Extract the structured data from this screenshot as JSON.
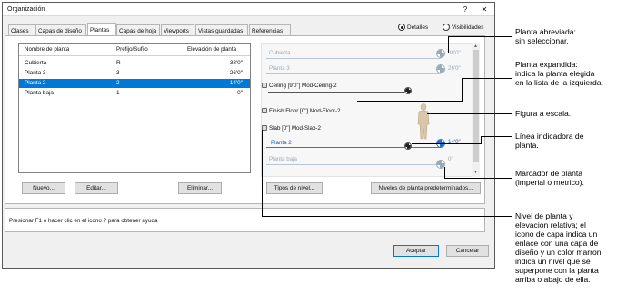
{
  "window": {
    "title": "Organización",
    "help_glyph": "?",
    "close_glyph": "✕"
  },
  "tabs": [
    {
      "label": "Clases"
    },
    {
      "label": "Capas de diseño"
    },
    {
      "label": "Plantas"
    },
    {
      "label": "Capas de hoja"
    },
    {
      "label": "Viewports"
    },
    {
      "label": "Vistas guardadas"
    },
    {
      "label": "Referencias"
    }
  ],
  "view_mode": {
    "detalles": "Detalles",
    "visibilidades": "Visibilidades",
    "selected": "Detalles"
  },
  "story_table": {
    "headers": {
      "name": "Nombre de planta",
      "suffix": "Prefijo/Sufijo",
      "elevation": "Elevación de planta"
    },
    "rows": [
      {
        "name": "Cubierta",
        "suffix": "R",
        "elevation": "38'0\""
      },
      {
        "name": "Planta 3",
        "suffix": "3",
        "elevation": "26'0\""
      },
      {
        "name": "Planta 2",
        "suffix": "2",
        "elevation": "14'0\"",
        "selected": true
      },
      {
        "name": "Planta baja",
        "suffix": "1",
        "elevation": "0\""
      }
    ]
  },
  "list_buttons": {
    "new": "Nuevo...",
    "edit": "Editar...",
    "delete": "Eliminar..."
  },
  "viewport": {
    "stories": [
      {
        "name": "Cubierta",
        "elevation": "38'0\""
      },
      {
        "name": "Planta 3",
        "elevation": "26'0\""
      },
      {
        "name": "Planta 2",
        "elevation": "14'0\""
      },
      {
        "name": "Planta baja",
        "elevation": "0\""
      }
    ],
    "levels": [
      {
        "label": "Ceiling [9'0\"] Mod-Ceiling-2"
      },
      {
        "label": "Finish Floor [0\"] Mod-Floor-2"
      },
      {
        "label": "Slab [0\"] Mod-Slab-2"
      }
    ],
    "buttons": {
      "level_types": "Tipos de nivel...",
      "default_levels": "Niveles de planta predeterminados..."
    }
  },
  "status": {
    "help_text": "Presionar F1 o hacer clic en el icono ? para obtener ayuda"
  },
  "footer": {
    "ok": "Aceptar",
    "cancel": "Cancelar"
  },
  "callouts": {
    "collapsed_story": [
      "Planta abreviada:",
      "sin seleccionar."
    ],
    "expanded_story": [
      "Planta expandida:",
      "indica la planta elegida",
      "en la lista de la izquierda."
    ],
    "scale_figure": [
      "Figura a escala."
    ],
    "story_line": [
      "Línea indicadora de",
      "planta."
    ],
    "story_marker": [
      "Marcador de planta",
      "(imperial o metrico)."
    ],
    "level_note": [
      "Nivel de planta y",
      "elevacion relativa; el",
      "icono de capa indica un",
      "enlace con una capa de",
      "diseño y un color marron",
      "indica un nivel que se",
      "superpone con la planta",
      "arriba o abajo de ella."
    ]
  },
  "colors": {
    "accent": "#0078d7",
    "story_faded": "#9aa9b8",
    "story_blue": "#1e5aa0",
    "overlap_brown": "#8b5a2b"
  }
}
